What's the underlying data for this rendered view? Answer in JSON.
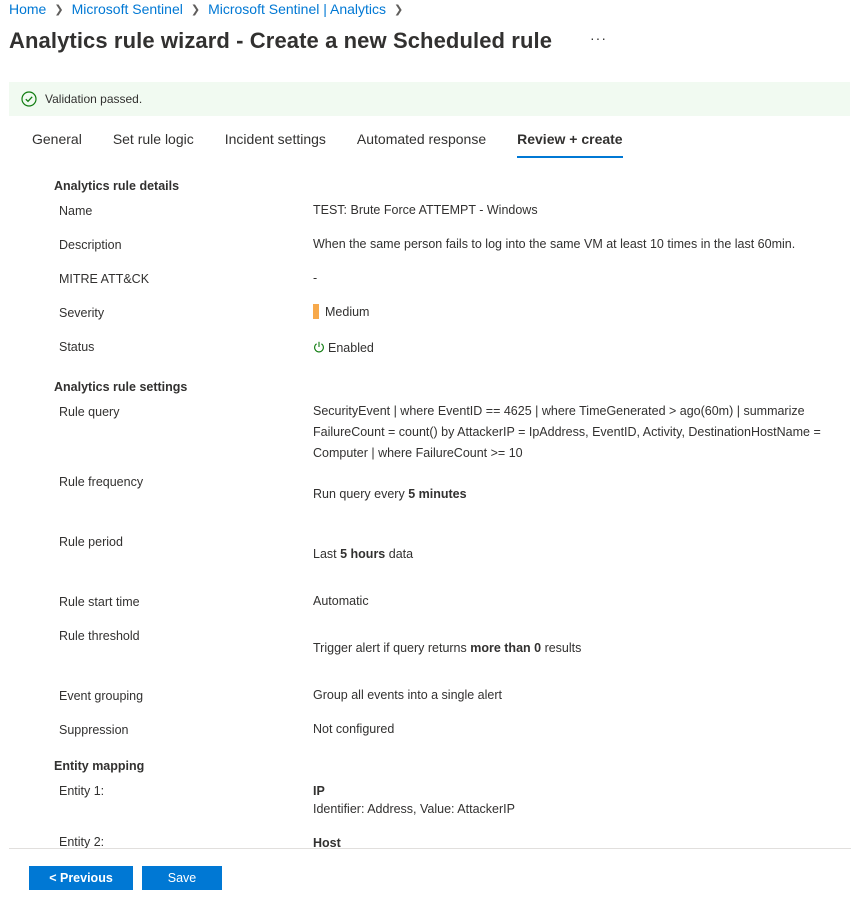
{
  "breadcrumb": [
    "Home",
    "Microsoft Sentinel",
    "Microsoft Sentinel | Analytics"
  ],
  "page_title": "Analytics rule wizard - Create a new Scheduled rule",
  "more_label": "···",
  "validation": {
    "text": "Validation passed.",
    "icon": "check-circle-icon",
    "color": "#107c10"
  },
  "tabs": [
    {
      "label": "General"
    },
    {
      "label": "Set rule logic"
    },
    {
      "label": "Incident settings"
    },
    {
      "label": "Automated response"
    },
    {
      "label": "Review + create",
      "active": true
    }
  ],
  "sections": {
    "details": "Analytics rule details",
    "settings": "Analytics rule settings",
    "entity": "Entity mapping"
  },
  "details": {
    "name_label": "Name",
    "name_value": "TEST: Brute Force ATTEMPT - Windows",
    "desc_label": "Description",
    "desc_value": "When the same person fails to log into the same VM at least 10 times in the last 60min.",
    "mitre_label": "MITRE ATT&CK",
    "mitre_value": "-",
    "severity_label": "Severity",
    "severity_value": "Medium",
    "severity_color": "#f7a94b",
    "status_label": "Status",
    "status_value": "Enabled"
  },
  "settings": {
    "query_label": "Rule query",
    "query_value": "SecurityEvent | where EventID == 4625 | where TimeGenerated > ago(60m) | summarize FailureCount = count() by AttackerIP = IpAddress, EventID, Activity, DestinationHostName = Computer | where FailureCount >= 10",
    "freq_label": "Rule frequency",
    "freq_prefix": "Run query every ",
    "freq_bold": "5 minutes",
    "period_label": "Rule period",
    "period_prefix": "Last ",
    "period_bold": "5 hours",
    "period_suffix": " data",
    "start_label": "Rule start time",
    "start_value": "Automatic",
    "threshold_label": "Rule threshold",
    "threshold_prefix": "Trigger alert if query returns ",
    "threshold_bold": "more than 0",
    "threshold_suffix": " results",
    "grouping_label": "Event grouping",
    "grouping_value": "Group all events into a single alert",
    "suppression_label": "Suppression",
    "suppression_value": "Not configured"
  },
  "entities": [
    {
      "label": "Entity 1:",
      "type": "IP",
      "detail": "Identifier: Address, Value: AttackerIP"
    },
    {
      "label": "Entity 2:",
      "type": "Host"
    }
  ],
  "footer": {
    "previous_label": "< Previous",
    "save_label": "Save"
  },
  "colors": {
    "accent": "#0078d4",
    "banner_bg": "#f1faf1",
    "enabled_icon": "#107c10"
  }
}
